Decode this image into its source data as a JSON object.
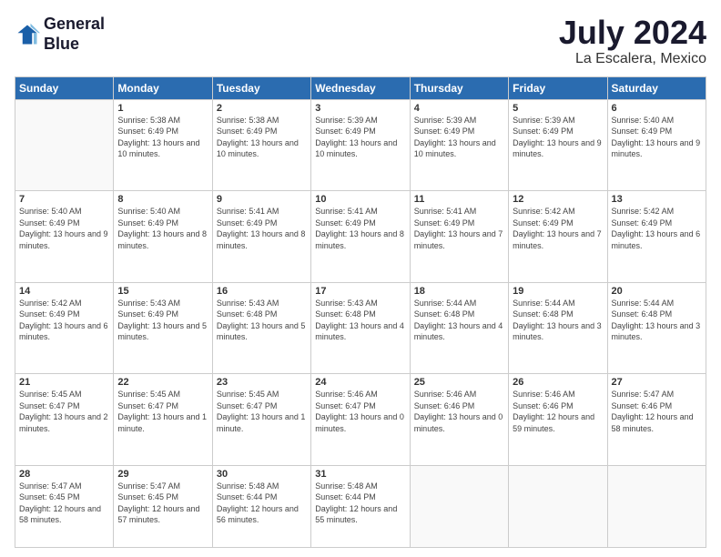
{
  "logo": {
    "line1": "General",
    "line2": "Blue"
  },
  "title": "July 2024",
  "location": "La Escalera, Mexico",
  "days_header": [
    "Sunday",
    "Monday",
    "Tuesday",
    "Wednesday",
    "Thursday",
    "Friday",
    "Saturday"
  ],
  "weeks": [
    [
      {
        "day": "",
        "info": ""
      },
      {
        "day": "1",
        "info": "Sunrise: 5:38 AM\nSunset: 6:49 PM\nDaylight: 13 hours\nand 10 minutes."
      },
      {
        "day": "2",
        "info": "Sunrise: 5:38 AM\nSunset: 6:49 PM\nDaylight: 13 hours\nand 10 minutes."
      },
      {
        "day": "3",
        "info": "Sunrise: 5:39 AM\nSunset: 6:49 PM\nDaylight: 13 hours\nand 10 minutes."
      },
      {
        "day": "4",
        "info": "Sunrise: 5:39 AM\nSunset: 6:49 PM\nDaylight: 13 hours\nand 10 minutes."
      },
      {
        "day": "5",
        "info": "Sunrise: 5:39 AM\nSunset: 6:49 PM\nDaylight: 13 hours\nand 9 minutes."
      },
      {
        "day": "6",
        "info": "Sunrise: 5:40 AM\nSunset: 6:49 PM\nDaylight: 13 hours\nand 9 minutes."
      }
    ],
    [
      {
        "day": "7",
        "info": "Sunrise: 5:40 AM\nSunset: 6:49 PM\nDaylight: 13 hours\nand 9 minutes."
      },
      {
        "day": "8",
        "info": "Sunrise: 5:40 AM\nSunset: 6:49 PM\nDaylight: 13 hours\nand 8 minutes."
      },
      {
        "day": "9",
        "info": "Sunrise: 5:41 AM\nSunset: 6:49 PM\nDaylight: 13 hours\nand 8 minutes."
      },
      {
        "day": "10",
        "info": "Sunrise: 5:41 AM\nSunset: 6:49 PM\nDaylight: 13 hours\nand 8 minutes."
      },
      {
        "day": "11",
        "info": "Sunrise: 5:41 AM\nSunset: 6:49 PM\nDaylight: 13 hours\nand 7 minutes."
      },
      {
        "day": "12",
        "info": "Sunrise: 5:42 AM\nSunset: 6:49 PM\nDaylight: 13 hours\nand 7 minutes."
      },
      {
        "day": "13",
        "info": "Sunrise: 5:42 AM\nSunset: 6:49 PM\nDaylight: 13 hours\nand 6 minutes."
      }
    ],
    [
      {
        "day": "14",
        "info": "Sunrise: 5:42 AM\nSunset: 6:49 PM\nDaylight: 13 hours\nand 6 minutes."
      },
      {
        "day": "15",
        "info": "Sunrise: 5:43 AM\nSunset: 6:49 PM\nDaylight: 13 hours\nand 5 minutes."
      },
      {
        "day": "16",
        "info": "Sunrise: 5:43 AM\nSunset: 6:48 PM\nDaylight: 13 hours\nand 5 minutes."
      },
      {
        "day": "17",
        "info": "Sunrise: 5:43 AM\nSunset: 6:48 PM\nDaylight: 13 hours\nand 4 minutes."
      },
      {
        "day": "18",
        "info": "Sunrise: 5:44 AM\nSunset: 6:48 PM\nDaylight: 13 hours\nand 4 minutes."
      },
      {
        "day": "19",
        "info": "Sunrise: 5:44 AM\nSunset: 6:48 PM\nDaylight: 13 hours\nand 3 minutes."
      },
      {
        "day": "20",
        "info": "Sunrise: 5:44 AM\nSunset: 6:48 PM\nDaylight: 13 hours\nand 3 minutes."
      }
    ],
    [
      {
        "day": "21",
        "info": "Sunrise: 5:45 AM\nSunset: 6:47 PM\nDaylight: 13 hours\nand 2 minutes."
      },
      {
        "day": "22",
        "info": "Sunrise: 5:45 AM\nSunset: 6:47 PM\nDaylight: 13 hours\nand 1 minute."
      },
      {
        "day": "23",
        "info": "Sunrise: 5:45 AM\nSunset: 6:47 PM\nDaylight: 13 hours\nand 1 minute."
      },
      {
        "day": "24",
        "info": "Sunrise: 5:46 AM\nSunset: 6:47 PM\nDaylight: 13 hours\nand 0 minutes."
      },
      {
        "day": "25",
        "info": "Sunrise: 5:46 AM\nSunset: 6:46 PM\nDaylight: 13 hours\nand 0 minutes."
      },
      {
        "day": "26",
        "info": "Sunrise: 5:46 AM\nSunset: 6:46 PM\nDaylight: 12 hours\nand 59 minutes."
      },
      {
        "day": "27",
        "info": "Sunrise: 5:47 AM\nSunset: 6:46 PM\nDaylight: 12 hours\nand 58 minutes."
      }
    ],
    [
      {
        "day": "28",
        "info": "Sunrise: 5:47 AM\nSunset: 6:45 PM\nDaylight: 12 hours\nand 58 minutes."
      },
      {
        "day": "29",
        "info": "Sunrise: 5:47 AM\nSunset: 6:45 PM\nDaylight: 12 hours\nand 57 minutes."
      },
      {
        "day": "30",
        "info": "Sunrise: 5:48 AM\nSunset: 6:44 PM\nDaylight: 12 hours\nand 56 minutes."
      },
      {
        "day": "31",
        "info": "Sunrise: 5:48 AM\nSunset: 6:44 PM\nDaylight: 12 hours\nand 55 minutes."
      },
      {
        "day": "",
        "info": ""
      },
      {
        "day": "",
        "info": ""
      },
      {
        "day": "",
        "info": ""
      }
    ]
  ]
}
